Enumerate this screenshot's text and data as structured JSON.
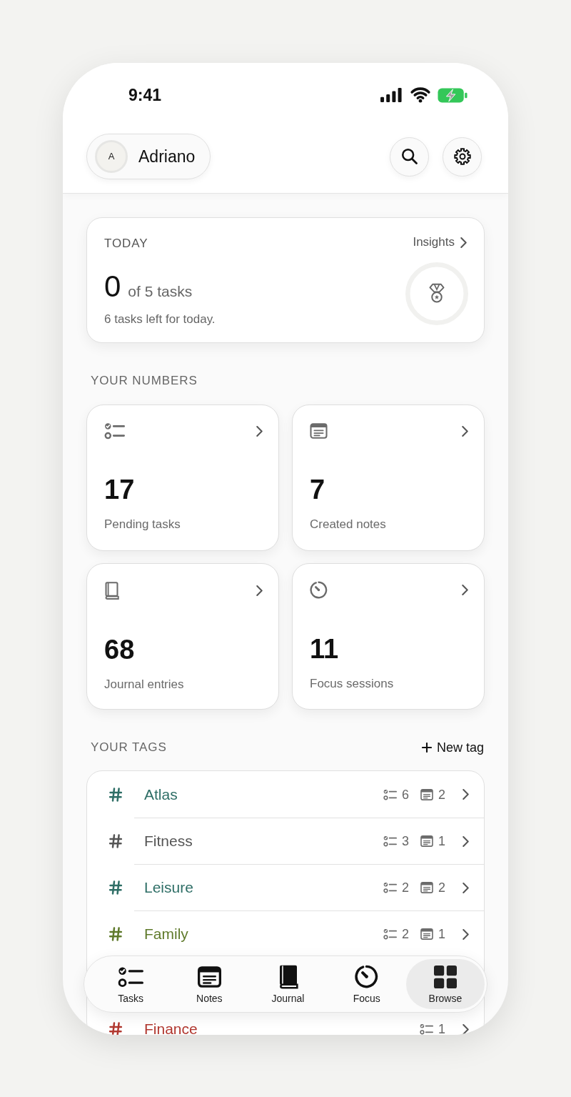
{
  "status_bar": {
    "time": "9:41"
  },
  "header": {
    "profile": {
      "initial": "A",
      "name": "Adriano"
    }
  },
  "today": {
    "title": "TODAY",
    "link": "Insights",
    "done": "0",
    "total": "of 5 tasks",
    "subtitle": "6 tasks left for today."
  },
  "numbers": {
    "title": "YOUR NUMBERS",
    "cards": [
      {
        "kind": "tasks",
        "value": "17",
        "label": "Pending tasks"
      },
      {
        "kind": "notes",
        "value": "7",
        "label": "Created notes"
      },
      {
        "kind": "journal",
        "value": "68",
        "label": "Journal entries"
      },
      {
        "kind": "focus",
        "value": "11",
        "label": "Focus sessions"
      }
    ]
  },
  "tags": {
    "title": "YOUR TAGS",
    "new_tag": "New tag",
    "items": [
      {
        "name": "Atlas",
        "color": "#2e6e66",
        "tasks": "6",
        "notes": "2"
      },
      {
        "name": "Fitness",
        "color": "#555555",
        "tasks": "3",
        "notes": "1"
      },
      {
        "name": "Leisure",
        "color": "#2e6e66",
        "tasks": "2",
        "notes": "2"
      },
      {
        "name": "Family",
        "color": "#5f7a2b",
        "tasks": "2",
        "notes": "1"
      },
      {
        "name": "Finance",
        "color": "#b1372f",
        "tasks": "1"
      }
    ]
  },
  "tab_bar": {
    "items": [
      {
        "kind": "tasks",
        "label": "Tasks",
        "selected": false
      },
      {
        "kind": "notes",
        "label": "Notes",
        "selected": false
      },
      {
        "kind": "journal",
        "label": "Journal",
        "selected": false
      },
      {
        "kind": "focus",
        "label": "Focus",
        "selected": false
      },
      {
        "kind": "browse",
        "label": "Browse",
        "selected": true
      }
    ]
  }
}
